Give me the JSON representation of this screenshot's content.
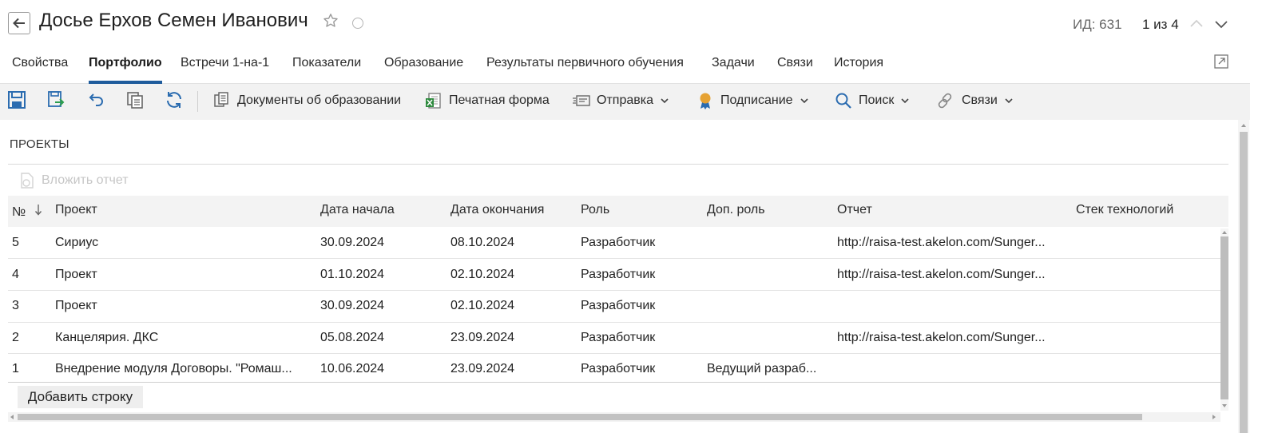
{
  "header": {
    "title": "Досье Ерхов Семен Иванович",
    "id_label": "ИД: 631",
    "pager": "1 из 4"
  },
  "tabs": [
    {
      "label": "Свойства"
    },
    {
      "label": "Портфолио"
    },
    {
      "label": "Встречи 1-на-1"
    },
    {
      "label": "Показатели"
    },
    {
      "label": "Образование"
    },
    {
      "label": "Результаты первичного обучения"
    },
    {
      "label": "Задачи"
    },
    {
      "label": "Связи"
    },
    {
      "label": "История"
    }
  ],
  "active_tab": "Портфолио",
  "toolbar": {
    "documents": "Документы об образовании",
    "print_form": "Печатная форма",
    "send": "Отправка",
    "sign": "Подписание",
    "search": "Поиск",
    "links": "Связи"
  },
  "section": {
    "title": "ПРОЕКТЫ",
    "attach_report": "Вложить отчет"
  },
  "grid": {
    "columns": [
      "№",
      "Проект",
      "Дата начала",
      "Дата окончания",
      "Роль",
      "Доп. роль",
      "Отчет",
      "Стек технологий"
    ],
    "rows": [
      {
        "num": "5",
        "project": "Сириус",
        "start": "30.09.2024",
        "end": "08.10.2024",
        "role": "Разработчик",
        "extra_role": "",
        "report": "http://raisa-test.akelon.com/Sunger...",
        "stack": ""
      },
      {
        "num": "4",
        "project": "Проект",
        "start": "01.10.2024",
        "end": "02.10.2024",
        "role": "Разработчик",
        "extra_role": "",
        "report": "http://raisa-test.akelon.com/Sunger...",
        "stack": ""
      },
      {
        "num": "3",
        "project": "Проект",
        "start": "30.09.2024",
        "end": "02.10.2024",
        "role": "Разработчик",
        "extra_role": "",
        "report": "",
        "stack": ""
      },
      {
        "num": "2",
        "project": "Канцелярия. ДКС",
        "start": "05.08.2024",
        "end": "23.09.2024",
        "role": "Разработчик",
        "extra_role": "",
        "report": "http://raisa-test.akelon.com/Sunger...",
        "stack": ""
      },
      {
        "num": "1",
        "project": "Внедрение модуля Договоры. \"Ромаш...",
        "start": "10.06.2024",
        "end": "23.09.2024",
        "role": "Разработчик",
        "extra_role": "Ведущий разраб...",
        "report": "",
        "stack": ""
      }
    ],
    "add_row": "Добавить строку"
  },
  "colors": {
    "accent": "#1f5c9c",
    "toolbar_bg": "#f2f2f2",
    "header_row_bg": "#f3f3f3"
  }
}
